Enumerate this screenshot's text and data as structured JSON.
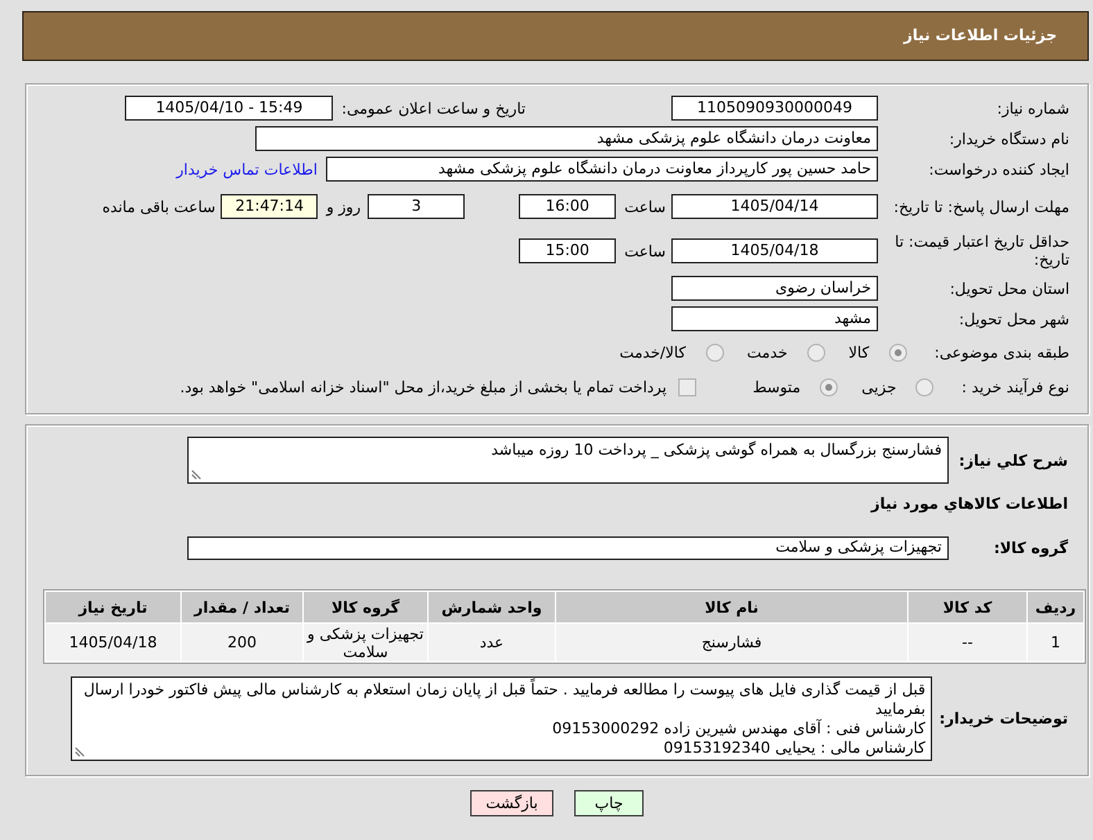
{
  "header": {
    "title": "جزئیات اطلاعات نیاز"
  },
  "details": {
    "rows": [
      {
        "kind": "two_fields",
        "label": "شماره نیاز:",
        "value": "1105090930000049",
        "label_2": "تاریخ و ساعت اعلان عمومی:",
        "value_2": "1405/04/10 - 15:49"
      },
      {
        "kind": "long_text",
        "label": "نام دستگاه خریدار:",
        "value": "معاونت درمان دانشگاه علوم پزشکی مشهد"
      },
      {
        "kind": "text_with_link",
        "label": "ایجاد کننده درخواست:",
        "value": "حامد حسین پور کارپرداز معاونت درمان دانشگاه علوم پزشکی مشهد",
        "link": "اطلاعات تماس خریدار"
      },
      {
        "kind": "deadline",
        "label": "مهلت ارسال پاسخ: تا تاریخ:",
        "date": "1405/04/14",
        "time_label": "ساعت",
        "time": "16:00",
        "days": "3",
        "days_label": "روز و",
        "remaining": "21:47:14",
        "remaining_label": "ساعت باقی مانده"
      },
      {
        "kind": "date_time",
        "label": "حداقل تاریخ اعتبار قیمت: تا تاریخ:",
        "date": "1405/04/18",
        "time_label": "ساعت",
        "time": "15:00"
      },
      {
        "kind": "short_text",
        "label": "استان محل تحویل:",
        "value": "خراسان رضوی"
      },
      {
        "kind": "short_text",
        "label": "شهر محل تحویل:",
        "value": "مشهد"
      },
      {
        "kind": "radios",
        "label": "طبقه بندی موضوعی:",
        "options": [
          {
            "label": "کالا",
            "selected": true
          },
          {
            "label": "خدمت",
            "selected": false
          },
          {
            "label": "کالا/خدمت",
            "selected": false
          }
        ]
      },
      {
        "kind": "radios_check",
        "label": "نوع فرآیند خرید :",
        "options": [
          {
            "label": "جزیی",
            "selected": false
          },
          {
            "label": "متوسط",
            "selected": true
          }
        ],
        "checkbox": {
          "label": "پرداخت تمام یا بخشی از مبلغ خرید،از محل \"اسناد خزانه اسلامی\" خواهد بود.",
          "checked": false
        }
      }
    ]
  },
  "needs": {
    "summary": {
      "label": "شرح کلي نياز:",
      "value": "فشارسنج بزرگسال به همراه گوشی پزشکی _ پرداخت 10 روزه میباشد"
    },
    "items_heading": "اطلاعات کالاهاي مورد نياز",
    "goods_group": {
      "label": "گروه کالا:",
      "value": "تجهیزات پزشکی و سلامت"
    },
    "table": {
      "columns": [
        "ردیف",
        "کد کالا",
        "نام کالا",
        "واحد شمارش",
        "گروه کالا",
        "تعداد / مقدار",
        "تاریخ نیاز"
      ],
      "rows": [
        [
          "1",
          "--",
          "فشارسنج",
          "عدد",
          "تجهیزات پزشکی و سلامت",
          "200",
          "1405/04/18"
        ]
      ]
    },
    "buyer_notes": {
      "label": "توضیحات خریدار:",
      "value": "قبل از قیمت گذاری فایل های پیوست را مطالعه فرمایید . حتماً قبل از پایان زمان استعلام به کارشناس مالی پیش فاکتور خودرا ارسال بفرمایید\nکارشناس فنی : آقای مهندس شیرین زاده 09153000292\nکارشناس مالی : یحیایی 09153192340"
    }
  },
  "buttons": [
    {
      "kind": "print",
      "label": "چاپ"
    },
    {
      "kind": "back",
      "label": "بازگشت"
    }
  ]
}
